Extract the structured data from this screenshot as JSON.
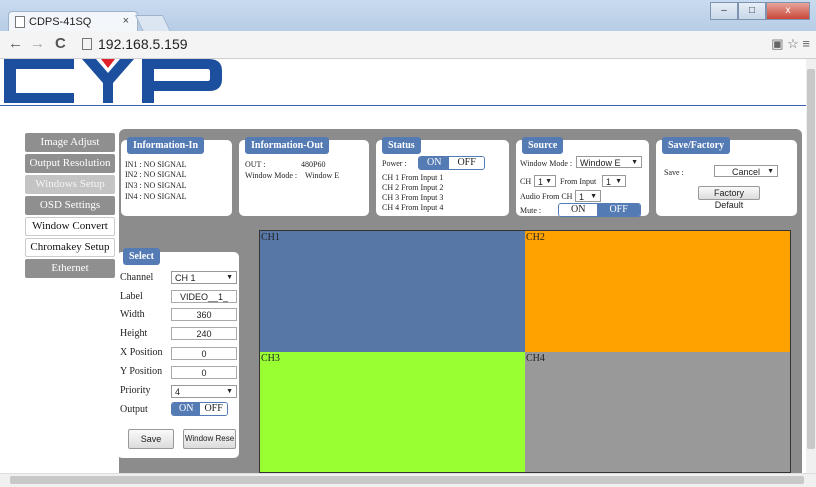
{
  "browser": {
    "tab_title": "CDPS-41SQ",
    "tab_close": "×",
    "url": "192.168.5.159",
    "back": "←",
    "forward": "→",
    "reload": "C",
    "win_min": "–",
    "win_max": "□",
    "win_close": "x"
  },
  "brand": {
    "logo_text": "CYP",
    "logo_colors": [
      "#1c4f9e",
      "#e0202a",
      "#1c4f9e"
    ]
  },
  "colors": {
    "accent": "#557bb5",
    "ch1": "#5778a6",
    "ch2": "#ffa200",
    "ch3": "#99ff33",
    "ch4": "#999999"
  },
  "sidebar": {
    "items": [
      {
        "label": "Image Adjust"
      },
      {
        "label": "Output Resolution"
      },
      {
        "label": "Windows Setup"
      },
      {
        "label": "OSD Settings"
      },
      {
        "label": "Window Convert"
      },
      {
        "label": "Chromakey Setup"
      },
      {
        "label": "Ethernet"
      }
    ]
  },
  "info_in": {
    "header": "Information-In",
    "lines": [
      "IN1 : NO SIGNAL",
      "IN2 : NO SIGNAL",
      "IN3 : NO SIGNAL",
      "IN4 : NO SIGNAL"
    ]
  },
  "info_out": {
    "header": "Information-Out",
    "out_label": "OUT :",
    "out_value": "480P60",
    "mode_label": "Window Mode :",
    "mode_value": "Window E"
  },
  "status": {
    "header": "Status",
    "power_label": "Power :",
    "on": "ON",
    "off": "OFF",
    "power_state": "ON",
    "lines": [
      "CH 1 From Input  1",
      "CH 2 From Input  2",
      "CH 3 From Input  3",
      "CH 4 From Input  4"
    ]
  },
  "source": {
    "header": "Source",
    "mode_label": "Window Mode :",
    "mode_value": "Window E",
    "ch_label": "CH",
    "ch_value": "1",
    "from_label": "From Input",
    "from_value": "1",
    "audio_label": "Audio From CH",
    "audio_value": "1",
    "mute_label": "Mute :",
    "on": "ON",
    "off": "OFF",
    "mute_state": "OFF"
  },
  "save_factory": {
    "header": "Save/Factory",
    "save_label": "Save :",
    "save_value": "Cancel",
    "factory_button": "Factory Default"
  },
  "select_panel": {
    "header": "Select",
    "channel_label": "Channel",
    "channel_value": "CH 1",
    "label_label": "Label",
    "label_value": "VIDEO__1_",
    "width_label": "Width",
    "width_value": "360",
    "height_label": "Height",
    "height_value": "240",
    "xpos_label": "X Position",
    "xpos_value": "0",
    "ypos_label": "Y Position",
    "ypos_value": "0",
    "priority_label": "Priority",
    "priority_value": "4",
    "output_label": "Output",
    "on": "ON",
    "off": "OFF",
    "output_state": "ON",
    "save_button": "Save",
    "reset_button": "Window Rese"
  },
  "windows": [
    {
      "label": "CH1"
    },
    {
      "label": "CH2"
    },
    {
      "label": "CH3"
    },
    {
      "label": "CH4"
    }
  ]
}
